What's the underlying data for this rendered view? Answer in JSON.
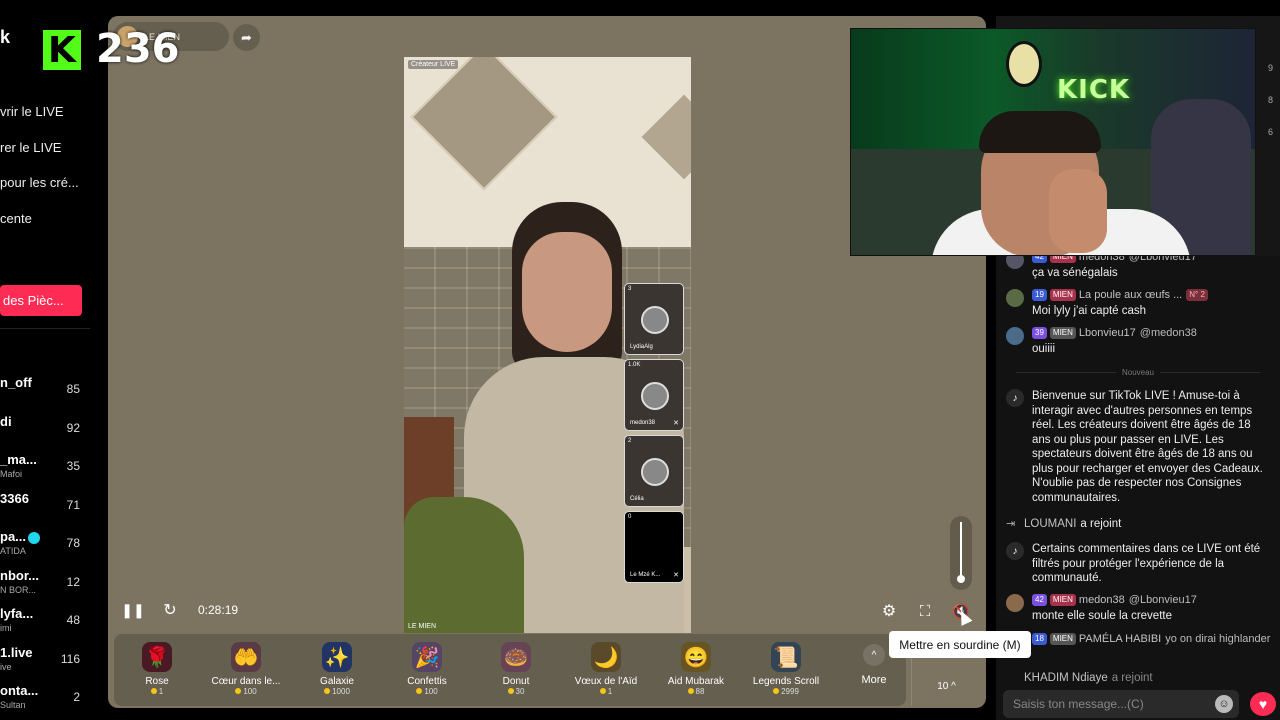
{
  "sidebar": {
    "brand": "k",
    "menu": [
      "vrir le LIVE",
      "rer le LIVE",
      "pour les cré...",
      "cente"
    ],
    "coins_button": "des Pièc...",
    "users": [
      {
        "name": "n_off",
        "sub": "",
        "count": "85"
      },
      {
        "name": "di",
        "sub": "",
        "count": "92"
      },
      {
        "name": "_ma...",
        "sub": "Mafoi",
        "count": "35"
      },
      {
        "name": "3366",
        "sub": "",
        "count": "71"
      },
      {
        "name": "pa...",
        "sub": "ATIDA",
        "count": "78"
      },
      {
        "name": "nbor...",
        "sub": "N BOR...",
        "count": "12"
      },
      {
        "name": "lyfa...",
        "sub": "imi",
        "count": "48"
      },
      {
        "name": "1.live",
        "sub": "ive",
        "count": "116"
      },
      {
        "name": "onta...",
        "sub": "Sultan",
        "count": "2"
      }
    ]
  },
  "kick": {
    "logo": "K",
    "viewers": "236"
  },
  "stream": {
    "host_name": "LE MIEN",
    "video_label_tl": "Créateur LIVE",
    "video_label_bl": "LE MIEN",
    "guests": [
      {
        "name": "LydiaAlg",
        "tag": "3"
      },
      {
        "name": "medon38",
        "tag": "1.0K"
      },
      {
        "name": "Célia",
        "tag": "2"
      },
      {
        "name": "Le Mzé K...",
        "tag": "0"
      }
    ],
    "time": "0:28:19",
    "volume_level": 0.05,
    "gifts": [
      {
        "name": "Rose",
        "price": "1",
        "icon": "🌹",
        "color": "#4a1a24"
      },
      {
        "name": "Cœur dans le...",
        "price": "100",
        "icon": "🤲",
        "color": "#5a3a44"
      },
      {
        "name": "Galaxie",
        "price": "1000",
        "icon": "✨",
        "color": "#223366"
      },
      {
        "name": "Confettis",
        "price": "100",
        "icon": "🎉",
        "color": "#554466"
      },
      {
        "name": "Donut",
        "price": "30",
        "icon": "🍩",
        "color": "#664455"
      },
      {
        "name": "Vœux de l'Aïd",
        "price": "1",
        "icon": "🌙",
        "color": "#5a4a2a"
      },
      {
        "name": "Aid Mubarak",
        "price": "88",
        "icon": "😄",
        "color": "#665522"
      },
      {
        "name": "Legends Scroll",
        "price": "2999",
        "icon": "📜",
        "color": "#334455"
      }
    ],
    "more_label": "More",
    "quantity": "10 ^",
    "tooltip": "Mettre en sourdine (M)"
  },
  "chat": {
    "side_numbers": [
      "9",
      "8",
      "6"
    ],
    "messages": [
      {
        "level": "42",
        "club": "MIEN",
        "user": "medon38",
        "text": "ça va sénégalais",
        "mention": "@Lbonvieu17"
      },
      {
        "level": "19",
        "club": "MIEN",
        "user": "La poule aux œufs ...",
        "rank": "N° 2",
        "text": "Moi lyly j'ai capté cash"
      },
      {
        "level": "39",
        "club": "MIEN",
        "user": "Lbonvieu17",
        "text": "ouiiii",
        "mention": "@medon38"
      }
    ],
    "nouveau": "Nouveau",
    "system_welcome": "Bienvenue sur TikTok LIVE ! Amuse-toi à interagir avec d'autres personnes en temps réel. Les créateurs doivent être âgés de 18 ans ou plus pour passer en LIVE. Les spectateurs doivent être âgés de 18 ans ou plus pour recharger et envoyer des Cadeaux. N'oublie pas de respecter nos Consignes communautaires.",
    "join1_user": "LOUMANI",
    "join_text": "a rejoint",
    "system_filter": "Certains commentaires dans ce LIVE ont été filtrés pour protéger l'expérience de la communauté.",
    "msg4": {
      "level": "42",
      "club": "MIEN",
      "user": "medon38",
      "mention": "@Lbonvieu17",
      "text": "monte elle soule la crevette"
    },
    "msg5": {
      "level": "18",
      "club": "MIEN",
      "user": "PAMÉLA HABIBI",
      "text": "yo on dirai highlander"
    },
    "join2_user": "KHADIM Ndiaye",
    "input_placeholder": "Saisis ton message...(C)"
  }
}
